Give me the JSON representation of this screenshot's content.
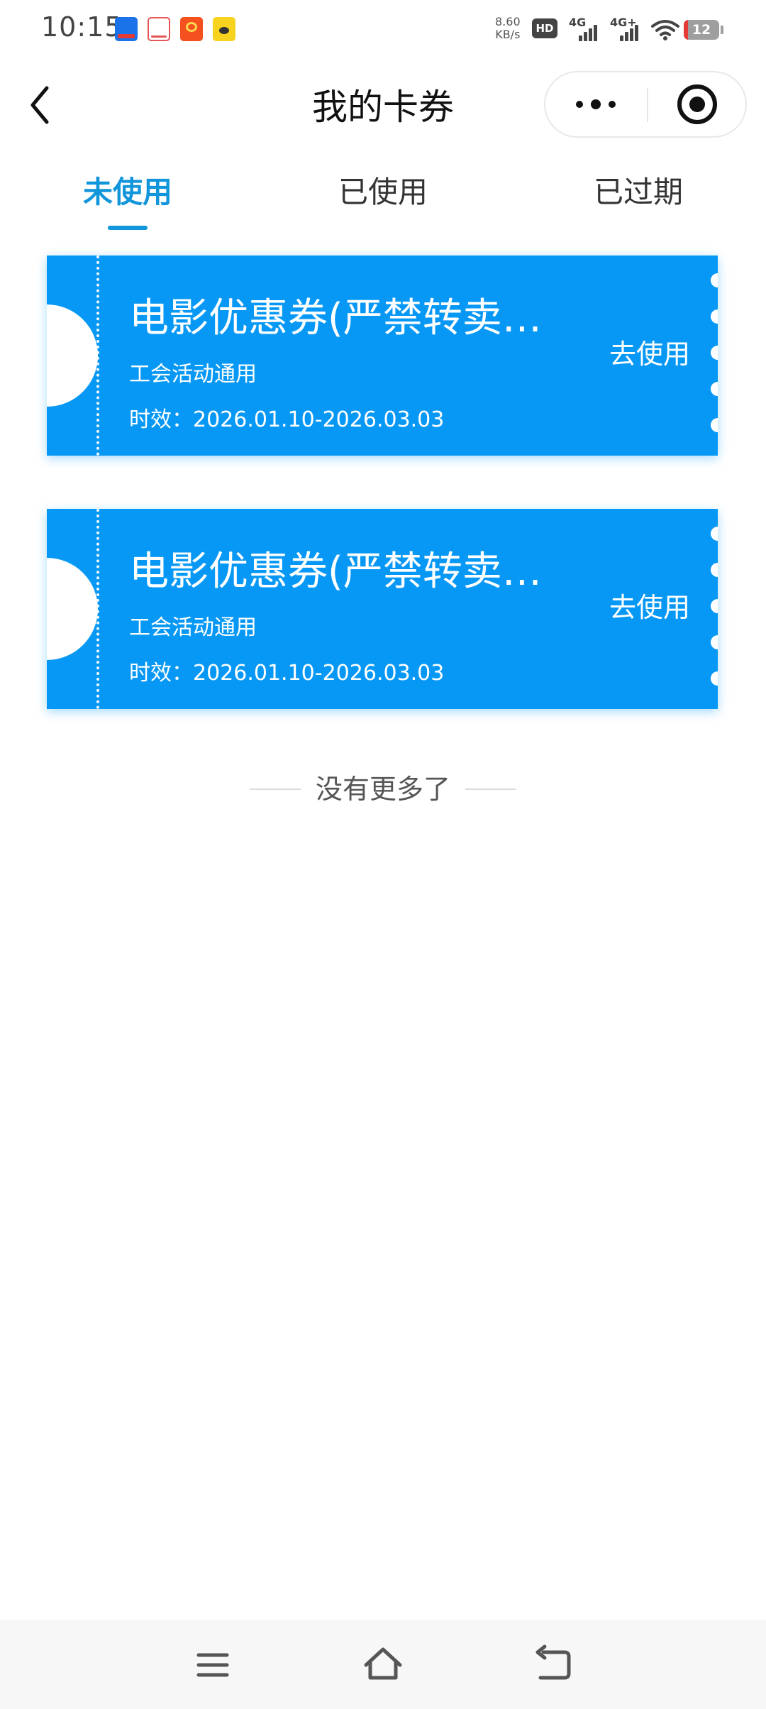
{
  "status_bar": {
    "time": "10:15",
    "net_speed_value": "8.60",
    "net_speed_unit": "KB/s",
    "hd_label": "HD",
    "signal_1_label": "4G",
    "signal_2_label": "4G+",
    "battery_level": "12",
    "notification_icons": [
      "alipay-icon",
      "cloud-app-icon",
      "red-app-icon",
      "yellow-app-icon"
    ]
  },
  "nav": {
    "title": "我的卡券",
    "back_icon": "chevron-left-icon",
    "more_icon": "more-dots-icon",
    "close_icon": "target-close-icon"
  },
  "tabs": [
    {
      "label": "未使用",
      "active": true
    },
    {
      "label": "已使用",
      "active": false
    },
    {
      "label": "已过期",
      "active": false
    }
  ],
  "coupons": [
    {
      "title": "电影优惠券(严禁转卖…",
      "scope": "工会活动通用",
      "validity": "时效：2026.01.10-2026.03.03",
      "action": "去使用"
    },
    {
      "title": "电影优惠券(严禁转卖…",
      "scope": "工会活动通用",
      "validity": "时效：2026.01.10-2026.03.03",
      "action": "去使用"
    }
  ],
  "list_end_text": "没有更多了",
  "system_nav": {
    "menu_icon": "menu-icon",
    "home_icon": "home-icon",
    "back_icon": "back-arrow-icon"
  },
  "colors": {
    "accent": "#1296db",
    "coupon_bg": "#0798f5",
    "battery_low": "#e53935"
  }
}
